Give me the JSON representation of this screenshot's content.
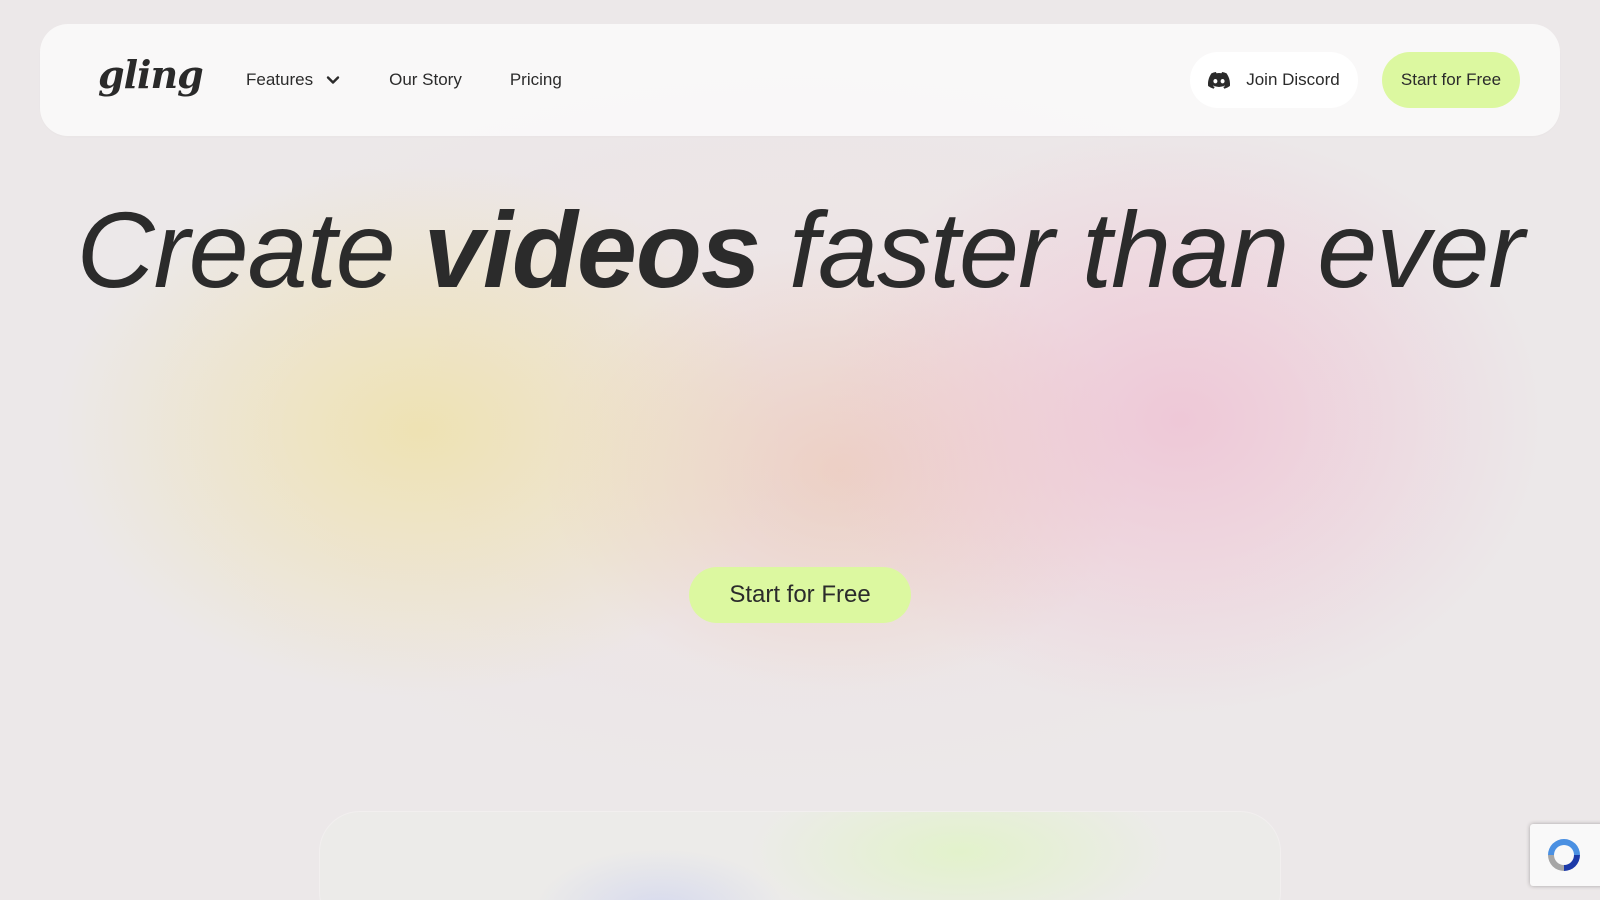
{
  "brand": {
    "logo_text": "gling"
  },
  "nav": {
    "links": [
      {
        "label": "Features",
        "has_dropdown": true
      },
      {
        "label": "Our Story"
      },
      {
        "label": "Pricing"
      }
    ],
    "discord_button": {
      "label": "Join Discord",
      "icon": "discord-icon"
    },
    "cta_label": "Start for Free"
  },
  "hero": {
    "headline_part1": "Create ",
    "headline_bold": "videos",
    "headline_part2": " faster than ever",
    "cta_label": "Start for Free"
  },
  "colors": {
    "accent": "#dcf8a0",
    "text": "#2b2b2b",
    "nav_background": "#faf9f9"
  },
  "widgets": {
    "recaptcha_icon": "recaptcha-icon"
  }
}
